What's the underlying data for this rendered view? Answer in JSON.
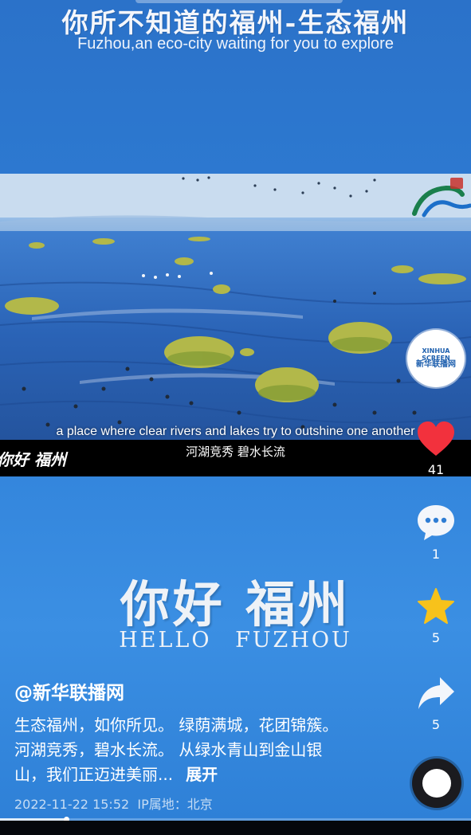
{
  "header": {
    "title_zh": "你所不知道的福州-生态福州",
    "title_en": "Fuzhou,an eco-city waiting for you to explore"
  },
  "video": {
    "caption_en": "a place where clear rivers and lakes try to outshine one another",
    "caption_zh": "河湖竞秀 碧水长流",
    "corner_logo": "你好 福州"
  },
  "overlay": {
    "hello_zh": "你好 福州",
    "hello_en": "HELLO FUZHOU"
  },
  "sidebar": {
    "avatar_line1": "XINHUA SCREEN",
    "avatar_line2": "新华联播网",
    "like_count": "41",
    "comment_count": "1",
    "favorite_count": "5",
    "share_count": "5",
    "like_color": "#f2313d",
    "favorite_color": "#f7c21b"
  },
  "post": {
    "author": "@新华联播网",
    "description": "生态福州，如你所见。 绿荫满城，花团锦簇。 河湖竞秀，碧水长流。 从绿水青山到金山银山，我们正迈进美丽...",
    "expand_label": "展开",
    "timestamp": "2022-11-22 15:52",
    "location": "IP属地：北京",
    "progress": 0.14
  }
}
